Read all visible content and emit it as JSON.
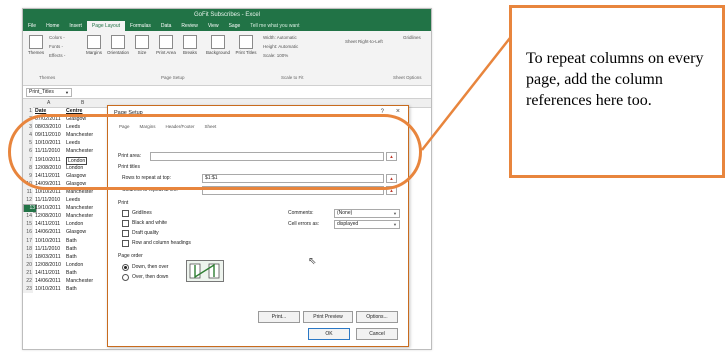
{
  "screenshot": {
    "window_title": "GoFit Subscribes - Excel",
    "tabs": [
      "File",
      "Home",
      "Insert",
      "Page Layout",
      "Formulas",
      "Data",
      "Review",
      "View",
      "Sage"
    ],
    "active_tab": "Page Layout",
    "tell_me": "Tell me what you want",
    "ribbon": {
      "colors": "Colors -",
      "fonts": "Fonts -",
      "effects": "Effects -",
      "themes_btn": "Themes",
      "margins": "Margins",
      "orientation": "Orientation",
      "size": "Size",
      "print_area": "Print Area",
      "breaks": "Breaks",
      "background": "Background",
      "print_titles": "Print Titles",
      "width": "Width: Automatic",
      "height": "Height: Automatic",
      "scale": "Scale: 100%",
      "sheet_right_to_left": "Sheet Right-to-Left",
      "gridlines": "Gridlines",
      "group_themes": "Themes",
      "group_page_setup": "Page Setup",
      "group_scale": "Scale to Fit",
      "group_sheet_options": "Sheet Options"
    },
    "name_box": "Print_Titles",
    "columns": [
      "A",
      "B"
    ],
    "rows": [
      {
        "num": "1",
        "date": "Date",
        "centre": "Centre",
        "header": true
      },
      {
        "num": "2",
        "date": "07/02/2011",
        "centre": "Glasgow"
      },
      {
        "num": "3",
        "date": "08/03/2010",
        "centre": "Leeds"
      },
      {
        "num": "4",
        "date": "09/11/2010",
        "centre": "Manchester"
      },
      {
        "num": "5",
        "date": "10/10/2011",
        "centre": "Leeds"
      },
      {
        "num": "6",
        "date": "11/11/2010",
        "centre": "Manchester"
      },
      {
        "num": "7",
        "date": "19/10/2011",
        "centre": "London",
        "boxed": true
      },
      {
        "num": "8",
        "date": "12/08/2010",
        "centre": "London"
      },
      {
        "num": "9",
        "date": "14/11/2011",
        "centre": "Glasgow"
      },
      {
        "num": "10",
        "date": "14/09/2011",
        "centre": "Glasgow"
      },
      {
        "num": "11",
        "date": "10/10/2011",
        "centre": "Manchester"
      },
      {
        "num": "12",
        "date": "11/11/2010",
        "centre": "Leeds"
      },
      {
        "num": "13",
        "date": "19/10/2011",
        "centre": "Manchester",
        "selected": true
      },
      {
        "num": "14",
        "date": "12/08/2010",
        "centre": "Manchester"
      },
      {
        "num": "15",
        "date": "14/11/2011",
        "centre": "London"
      },
      {
        "num": "16",
        "date": "14/06/2011",
        "centre": "Glasgow"
      },
      {
        "num": "17",
        "date": "10/10/2011",
        "centre": "Bath"
      },
      {
        "num": "18",
        "date": "11/11/2010",
        "centre": "Bath"
      },
      {
        "num": "19",
        "date": "18/03/2011",
        "centre": "Bath"
      },
      {
        "num": "20",
        "date": "12/08/2010",
        "centre": "London"
      },
      {
        "num": "21",
        "date": "14/11/2011",
        "centre": "Bath"
      },
      {
        "num": "22",
        "date": "14/06/2011",
        "centre": "Manchester"
      },
      {
        "num": "23",
        "date": "10/10/2011",
        "centre": "Bath"
      }
    ],
    "dialog": {
      "title": "Page Setup",
      "help": "?",
      "close": "×",
      "tabs": [
        "Page",
        "Margins",
        "Header/Footer",
        "Sheet"
      ],
      "print_area_label": "Print area:",
      "print_area_value": "",
      "print_titles_label": "Print titles",
      "rows_label": "Rows to repeat at top:",
      "rows_value": "$1:$1",
      "cols_label": "Columns to repeat at left:",
      "cols_value": "",
      "print_label": "Print",
      "gridlines": "Gridlines",
      "black_white": "Black and white",
      "draft": "Draft quality",
      "row_col_headings": "Row and column headings",
      "comments_label": "Comments:",
      "comments_value": "(None)",
      "cell_errors_label": "Cell errors as:",
      "cell_errors_value": "displayed",
      "page_order_label": "Page order",
      "down_then_over": "Down, then over",
      "over_then_down": "Over, then down",
      "print_btn": "Print...",
      "print_preview_btn": "Print Preview",
      "options_btn": "Options...",
      "ok_btn": "OK",
      "cancel_btn": "Cancel"
    }
  },
  "callout": {
    "text": "To repeat columns on every page, add the column references here too."
  },
  "colors": {
    "excel_green": "#217346",
    "highlight_orange": "#e8853d"
  }
}
